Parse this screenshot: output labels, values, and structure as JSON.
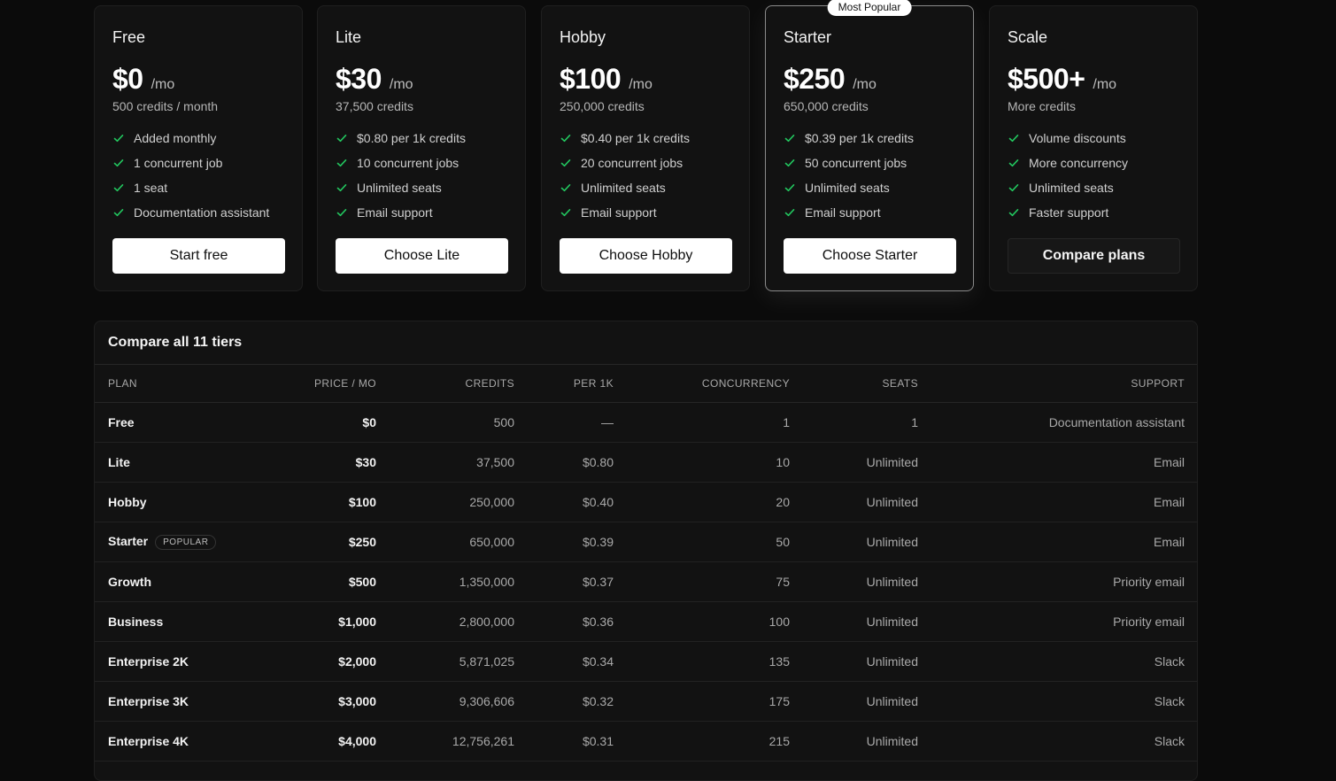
{
  "plans": [
    {
      "name": "Free",
      "price": "$0",
      "per": "/mo",
      "credits": "500 credits / month",
      "features": [
        "Added monthly",
        "1 concurrent job",
        "1 seat",
        "Documentation assistant"
      ],
      "cta": "Start free",
      "cta_style": "light"
    },
    {
      "name": "Lite",
      "price": "$30",
      "per": "/mo",
      "credits": "37,500 credits",
      "features": [
        "$0.80 per 1k credits",
        "10 concurrent jobs",
        "Unlimited seats",
        "Email support"
      ],
      "cta": "Choose Lite",
      "cta_style": "light"
    },
    {
      "name": "Hobby",
      "price": "$100",
      "per": "/mo",
      "credits": "250,000 credits",
      "features": [
        "$0.40 per 1k credits",
        "20 concurrent jobs",
        "Unlimited seats",
        "Email support"
      ],
      "cta": "Choose Hobby",
      "cta_style": "light"
    },
    {
      "name": "Starter",
      "price": "$250",
      "per": "/mo",
      "credits": "650,000 credits",
      "features": [
        "$0.39 per 1k credits",
        "50 concurrent jobs",
        "Unlimited seats",
        "Email support"
      ],
      "cta": "Choose Starter",
      "cta_style": "light",
      "badge": "Most Popular"
    },
    {
      "name": "Scale",
      "price": "$500+",
      "per": "/mo",
      "credits": "More credits",
      "features": [
        "Volume discounts",
        "More concurrency",
        "Unlimited seats",
        "Faster support"
      ],
      "cta": "Compare plans",
      "cta_style": "dark"
    }
  ],
  "compare": {
    "title": "Compare all 11 tiers",
    "columns": [
      "PLAN",
      "PRICE / MO",
      "CREDITS",
      "PER 1K",
      "CONCURRENCY",
      "SEATS",
      "SUPPORT"
    ],
    "popular_tag": "POPULAR",
    "rows": [
      {
        "plan": "Free",
        "price": "$0",
        "credits": "500",
        "per1k": "—",
        "concurrency": "1",
        "seats": "1",
        "support": "Documentation assistant"
      },
      {
        "plan": "Lite",
        "price": "$30",
        "credits": "37,500",
        "per1k": "$0.80",
        "concurrency": "10",
        "seats": "Unlimited",
        "support": "Email"
      },
      {
        "plan": "Hobby",
        "price": "$100",
        "credits": "250,000",
        "per1k": "$0.40",
        "concurrency": "20",
        "seats": "Unlimited",
        "support": "Email"
      },
      {
        "plan": "Starter",
        "price": "$250",
        "credits": "650,000",
        "per1k": "$0.39",
        "concurrency": "50",
        "seats": "Unlimited",
        "support": "Email",
        "popular": true
      },
      {
        "plan": "Growth",
        "price": "$500",
        "credits": "1,350,000",
        "per1k": "$0.37",
        "concurrency": "75",
        "seats": "Unlimited",
        "support": "Priority email"
      },
      {
        "plan": "Business",
        "price": "$1,000",
        "credits": "2,800,000",
        "per1k": "$0.36",
        "concurrency": "100",
        "seats": "Unlimited",
        "support": "Priority email"
      },
      {
        "plan": "Enterprise 2K",
        "price": "$2,000",
        "credits": "5,871,025",
        "per1k": "$0.34",
        "concurrency": "135",
        "seats": "Unlimited",
        "support": "Slack"
      },
      {
        "plan": "Enterprise 3K",
        "price": "$3,000",
        "credits": "9,306,606",
        "per1k": "$0.32",
        "concurrency": "175",
        "seats": "Unlimited",
        "support": "Slack"
      },
      {
        "plan": "Enterprise 4K",
        "price": "$4,000",
        "credits": "12,756,261",
        "per1k": "$0.31",
        "concurrency": "215",
        "seats": "Unlimited",
        "support": "Slack"
      }
    ]
  },
  "colors": {
    "check": "#22c55e",
    "background": "#0b0b0b",
    "card": "#121212"
  },
  "icons": {
    "feature": "check-icon"
  }
}
